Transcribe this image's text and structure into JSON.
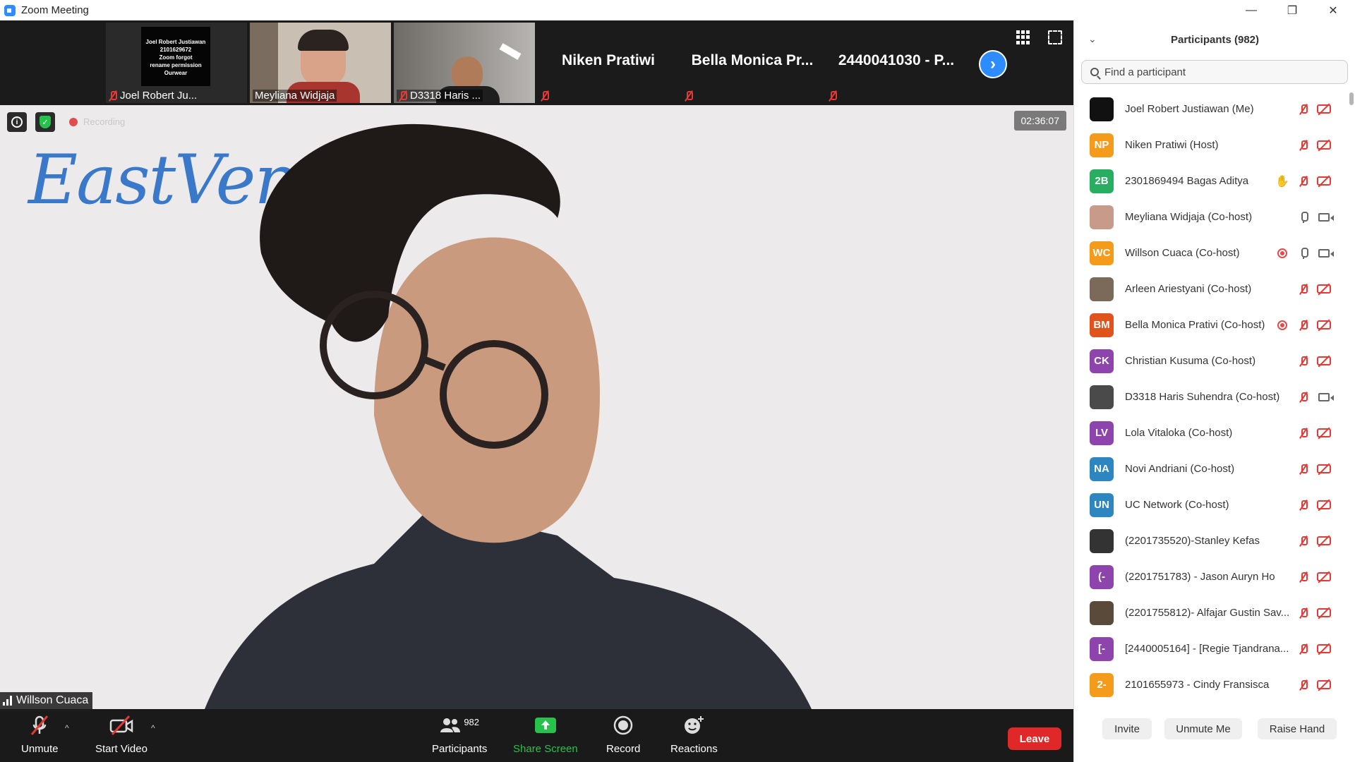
{
  "window": {
    "title": "Zoom Meeting",
    "minimize_glyph": "—",
    "restore_glyph": "❐",
    "close_glyph": "✕"
  },
  "strip": {
    "tiles": [
      {
        "name": "Joel Robert Ju...",
        "muted": true,
        "placard_lines": [
          "Joel Robert Justiawan",
          "2101629672",
          "Zoom forgot",
          "rename permission",
          "Ourwear"
        ]
      },
      {
        "name": "Meyliana Widjaja",
        "muted": false
      },
      {
        "name": "D3318 Haris ...",
        "muted": true
      },
      {
        "name": "Niken Pratiwi",
        "muted": true
      },
      {
        "name": "Bella Monica Pr...",
        "muted": true
      },
      {
        "name": "2440041030 - P...",
        "muted": true
      }
    ],
    "next_glyph": "›"
  },
  "speaker": {
    "name": "Willson Cuaca",
    "timer": "02:36:07",
    "recording_label": "Recording",
    "logo_text": "EastVentu",
    "info_glyph": "i",
    "shield_glyph": "✓"
  },
  "toolbar": {
    "unmute": "Unmute",
    "start_video": "Start Video",
    "participants": "Participants",
    "participants_count": "982",
    "share_screen": "Share Screen",
    "record": "Record",
    "reactions": "Reactions",
    "leave": "Leave",
    "caret_glyph": "^"
  },
  "panel": {
    "title": "Participants (982)",
    "collapse_glyph": "⌄",
    "search_placeholder": "Find a participant",
    "participants": [
      {
        "name": "Joel Robert Justiawan (Me)",
        "initials": "",
        "color": "#111111",
        "mic": "off",
        "video": "off",
        "extra": ""
      },
      {
        "name": "Niken Pratiwi (Host)",
        "initials": "NP",
        "color": "#f59b1b",
        "mic": "off",
        "video": "off",
        "extra": ""
      },
      {
        "name": "2301869494 Bagas Aditya",
        "initials": "2B",
        "color": "#27ae60",
        "mic": "off",
        "video": "off",
        "extra": "hand"
      },
      {
        "name": "Meyliana Widjaja (Co-host)",
        "initials": "",
        "color": "#c89a8a",
        "mic": "on",
        "video": "on",
        "extra": ""
      },
      {
        "name": "Willson Cuaca (Co-host)",
        "initials": "WC",
        "color": "#f59b1b",
        "mic": "on",
        "video": "on",
        "extra": "rec"
      },
      {
        "name": "Arleen Ariestyani (Co-host)",
        "initials": "",
        "color": "#7b6a5a",
        "mic": "off",
        "video": "off",
        "extra": ""
      },
      {
        "name": "Bella Monica Prativi (Co-host)",
        "initials": "BM",
        "color": "#e0531c",
        "mic": "off",
        "video": "off",
        "extra": "rec"
      },
      {
        "name": "Christian Kusuma (Co-host)",
        "initials": "CK",
        "color": "#8e44ad",
        "mic": "off",
        "video": "off",
        "extra": ""
      },
      {
        "name": "D3318 Haris Suhendra (Co-host)",
        "initials": "",
        "color": "#4a4a4a",
        "mic": "off",
        "video": "on",
        "extra": ""
      },
      {
        "name": "Lola Vitaloka (Co-host)",
        "initials": "LV",
        "color": "#8e44ad",
        "mic": "off",
        "video": "off",
        "extra": ""
      },
      {
        "name": "Novi Andriani (Co-host)",
        "initials": "NA",
        "color": "#2e86c1",
        "mic": "off",
        "video": "off",
        "extra": ""
      },
      {
        "name": "UC Network (Co-host)",
        "initials": "UN",
        "color": "#2e86c1",
        "mic": "off",
        "video": "off",
        "extra": ""
      },
      {
        "name": "(2201735520)-Stanley Kefas",
        "initials": "",
        "color": "#333333",
        "mic": "off",
        "video": "off",
        "extra": ""
      },
      {
        "name": "(2201751783) - Jason Auryn Ho",
        "initials": "(-",
        "color": "#8e44ad",
        "mic": "off",
        "video": "off",
        "extra": ""
      },
      {
        "name": "(2201755812)- Alfajar Gustin Sav...",
        "initials": "",
        "color": "#5a4a3a",
        "mic": "off",
        "video": "off",
        "extra": ""
      },
      {
        "name": "[2440005164] - [Regie Tjandrana...",
        "initials": "[-",
        "color": "#8e44ad",
        "mic": "off",
        "video": "off",
        "extra": ""
      },
      {
        "name": "2101655973 - Cindy Fransisca",
        "initials": "2-",
        "color": "#f59b1b",
        "mic": "off",
        "video": "off",
        "extra": ""
      }
    ],
    "invite": "Invite",
    "unmute_me": "Unmute Me",
    "raise_hand": "Raise Hand"
  }
}
